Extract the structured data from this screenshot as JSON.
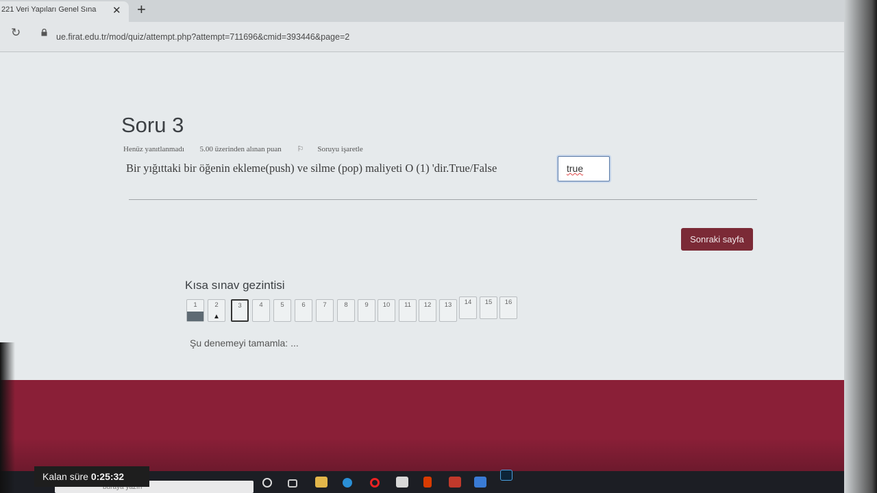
{
  "browser": {
    "tab_title": "221 Veri Yapıları Genel Sına",
    "tab_close": "✕",
    "new_tab": "+",
    "url": "ue.firat.edu.tr/mod/quiz/attempt.php?attempt=711696&cmid=393446&page=2"
  },
  "question": {
    "title": "Soru 3",
    "status": "Henüz yanıtlanmadı",
    "points": "5.00 üzerinden alınan puan",
    "flag_label": "Soruyu işaretle",
    "text": "Bir yığıttaki bir öğenin ekleme(push) ve silme (pop) maliyeti O (1) 'dir.True/False",
    "answer_value": "true"
  },
  "next_button": "Sonraki sayfa",
  "quiz_nav": {
    "title": "Kısa sınav gezintisi",
    "items": [
      {
        "label": "1",
        "state": "answered"
      },
      {
        "label": "2",
        "state": "flagged"
      },
      {
        "label": "3",
        "state": "current"
      },
      {
        "label": "4",
        "state": "normal"
      },
      {
        "label": "5",
        "state": "normal"
      },
      {
        "label": "6",
        "state": "normal"
      },
      {
        "label": "7",
        "state": "normal"
      },
      {
        "label": "8",
        "state": "normal"
      },
      {
        "label": "9",
        "state": "normal"
      },
      {
        "label": "10",
        "state": "normal"
      },
      {
        "label": "11",
        "state": "normal"
      },
      {
        "label": "12",
        "state": "normal"
      },
      {
        "label": "13",
        "state": "normal"
      },
      {
        "label": "14",
        "state": "normal"
      },
      {
        "label": "15",
        "state": "normal"
      },
      {
        "label": "16",
        "state": "normal"
      }
    ],
    "finish_link": "Şu denemeyi tamamla: ..."
  },
  "timer": {
    "label": "Kalan süre",
    "value": "0:25:32"
  },
  "taskbar": {
    "search_placeholder": "buraya yazın"
  },
  "colors": {
    "accent": "#7b2a36",
    "footer": "#8a1f37"
  }
}
